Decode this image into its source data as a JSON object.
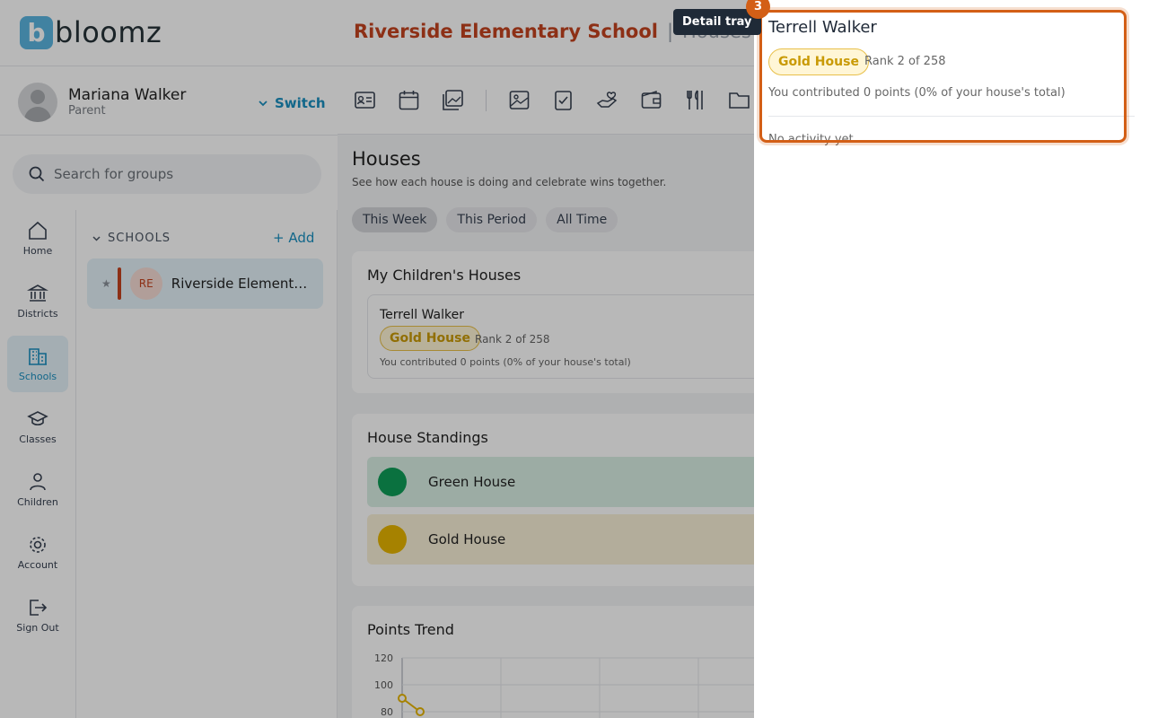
{
  "brand": {
    "name": "bloomz",
    "mark": "b"
  },
  "header": {
    "school": "Riverside Elementary School",
    "separator": "|",
    "section": "Houses"
  },
  "user": {
    "name": "Mariana Walker",
    "role": "Parent",
    "switch_label": "Switch"
  },
  "search": {
    "placeholder": "Search for groups"
  },
  "nav": [
    {
      "label": "Home",
      "icon": "home-icon"
    },
    {
      "label": "Districts",
      "icon": "districts-icon"
    },
    {
      "label": "Schools",
      "icon": "schools-icon",
      "active": true
    },
    {
      "label": "Classes",
      "icon": "classes-icon"
    },
    {
      "label": "Children",
      "icon": "children-icon"
    },
    {
      "label": "Account",
      "icon": "gear-icon"
    },
    {
      "label": "Sign Out",
      "icon": "sign-out-icon"
    }
  ],
  "groups": {
    "heading": "SCHOOLS",
    "add_label": "Add",
    "items": [
      {
        "initials": "RE",
        "name": "Riverside Elementary School"
      }
    ]
  },
  "toolbar": [
    "profile-card-icon",
    "calendar-icon",
    "photo-gallery-icon",
    "image-icon",
    "checklist-icon",
    "volunteer-hand-icon",
    "wallet-icon",
    "food-utensils-icon",
    "folder-icon"
  ],
  "houses": {
    "title": "Houses",
    "subtitle": "See how each house is doing and celebrate wins together.",
    "filters": [
      "This Week",
      "This Period",
      "All Time"
    ],
    "active_filter": "This Week",
    "my_children": {
      "title": "My Children's Houses",
      "child": {
        "name": "Terrell Walker",
        "house": "Gold House",
        "rank": "Rank 2 of 258",
        "contribution": "You contributed 0 points (0% of your house's total)"
      }
    },
    "standings": {
      "title": "House Standings",
      "items": [
        {
          "name": "Green House",
          "color": "#0f9d58",
          "bg": "#d9efe4"
        },
        {
          "name": "Gold House",
          "color": "#e6b400",
          "bg": "#f8f0d7"
        }
      ]
    },
    "trend": {
      "title": "Points Trend"
    }
  },
  "chart_data": {
    "type": "line",
    "title": "Points Trend",
    "yticks": [
      120,
      100,
      80
    ],
    "ylim": [
      80,
      120
    ],
    "series": [
      {
        "color": "#e6b400",
        "values": [
          90,
          80
        ]
      }
    ],
    "grid": true
  },
  "tray": {
    "callout": "Detail tray",
    "step": "3",
    "name": "Terrell Walker",
    "house": "Gold House",
    "rank": "Rank 2 of 258",
    "contribution": "You contributed 0 points (0% of your house's total)",
    "empty": "No activity yet."
  },
  "colors": {
    "accent": "#1a8fc0",
    "school": "#c4431f",
    "highlight": "#d35f16",
    "gold": "#e6b400"
  }
}
